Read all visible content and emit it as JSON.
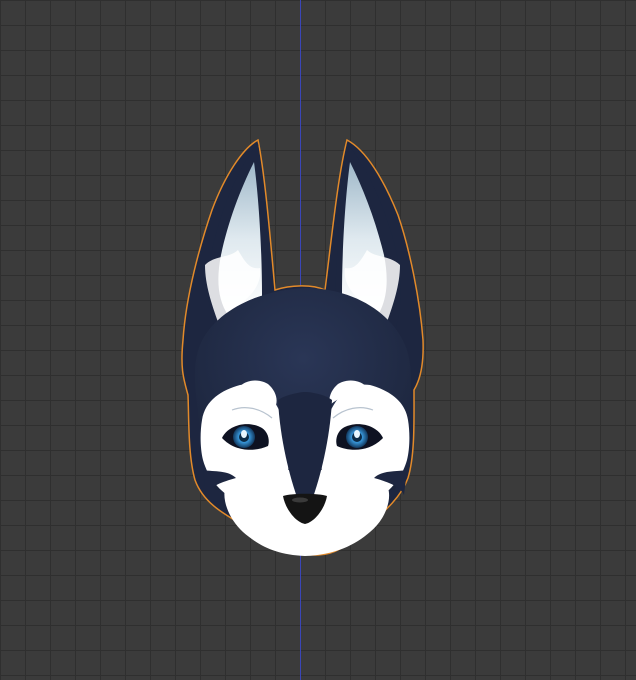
{
  "viewport": {
    "background": "#3b3b3b",
    "grid_color": "#2f2f2f",
    "axis_color": "#3a46b8",
    "selection_outline_color": "#e28a2a"
  },
  "model": {
    "colors": {
      "fur_dark": "#202a44",
      "fur_light": "#ffffff",
      "ear_inner": "#c7d8e2",
      "iris": "#2a84c8",
      "nose": "#141414"
    }
  }
}
